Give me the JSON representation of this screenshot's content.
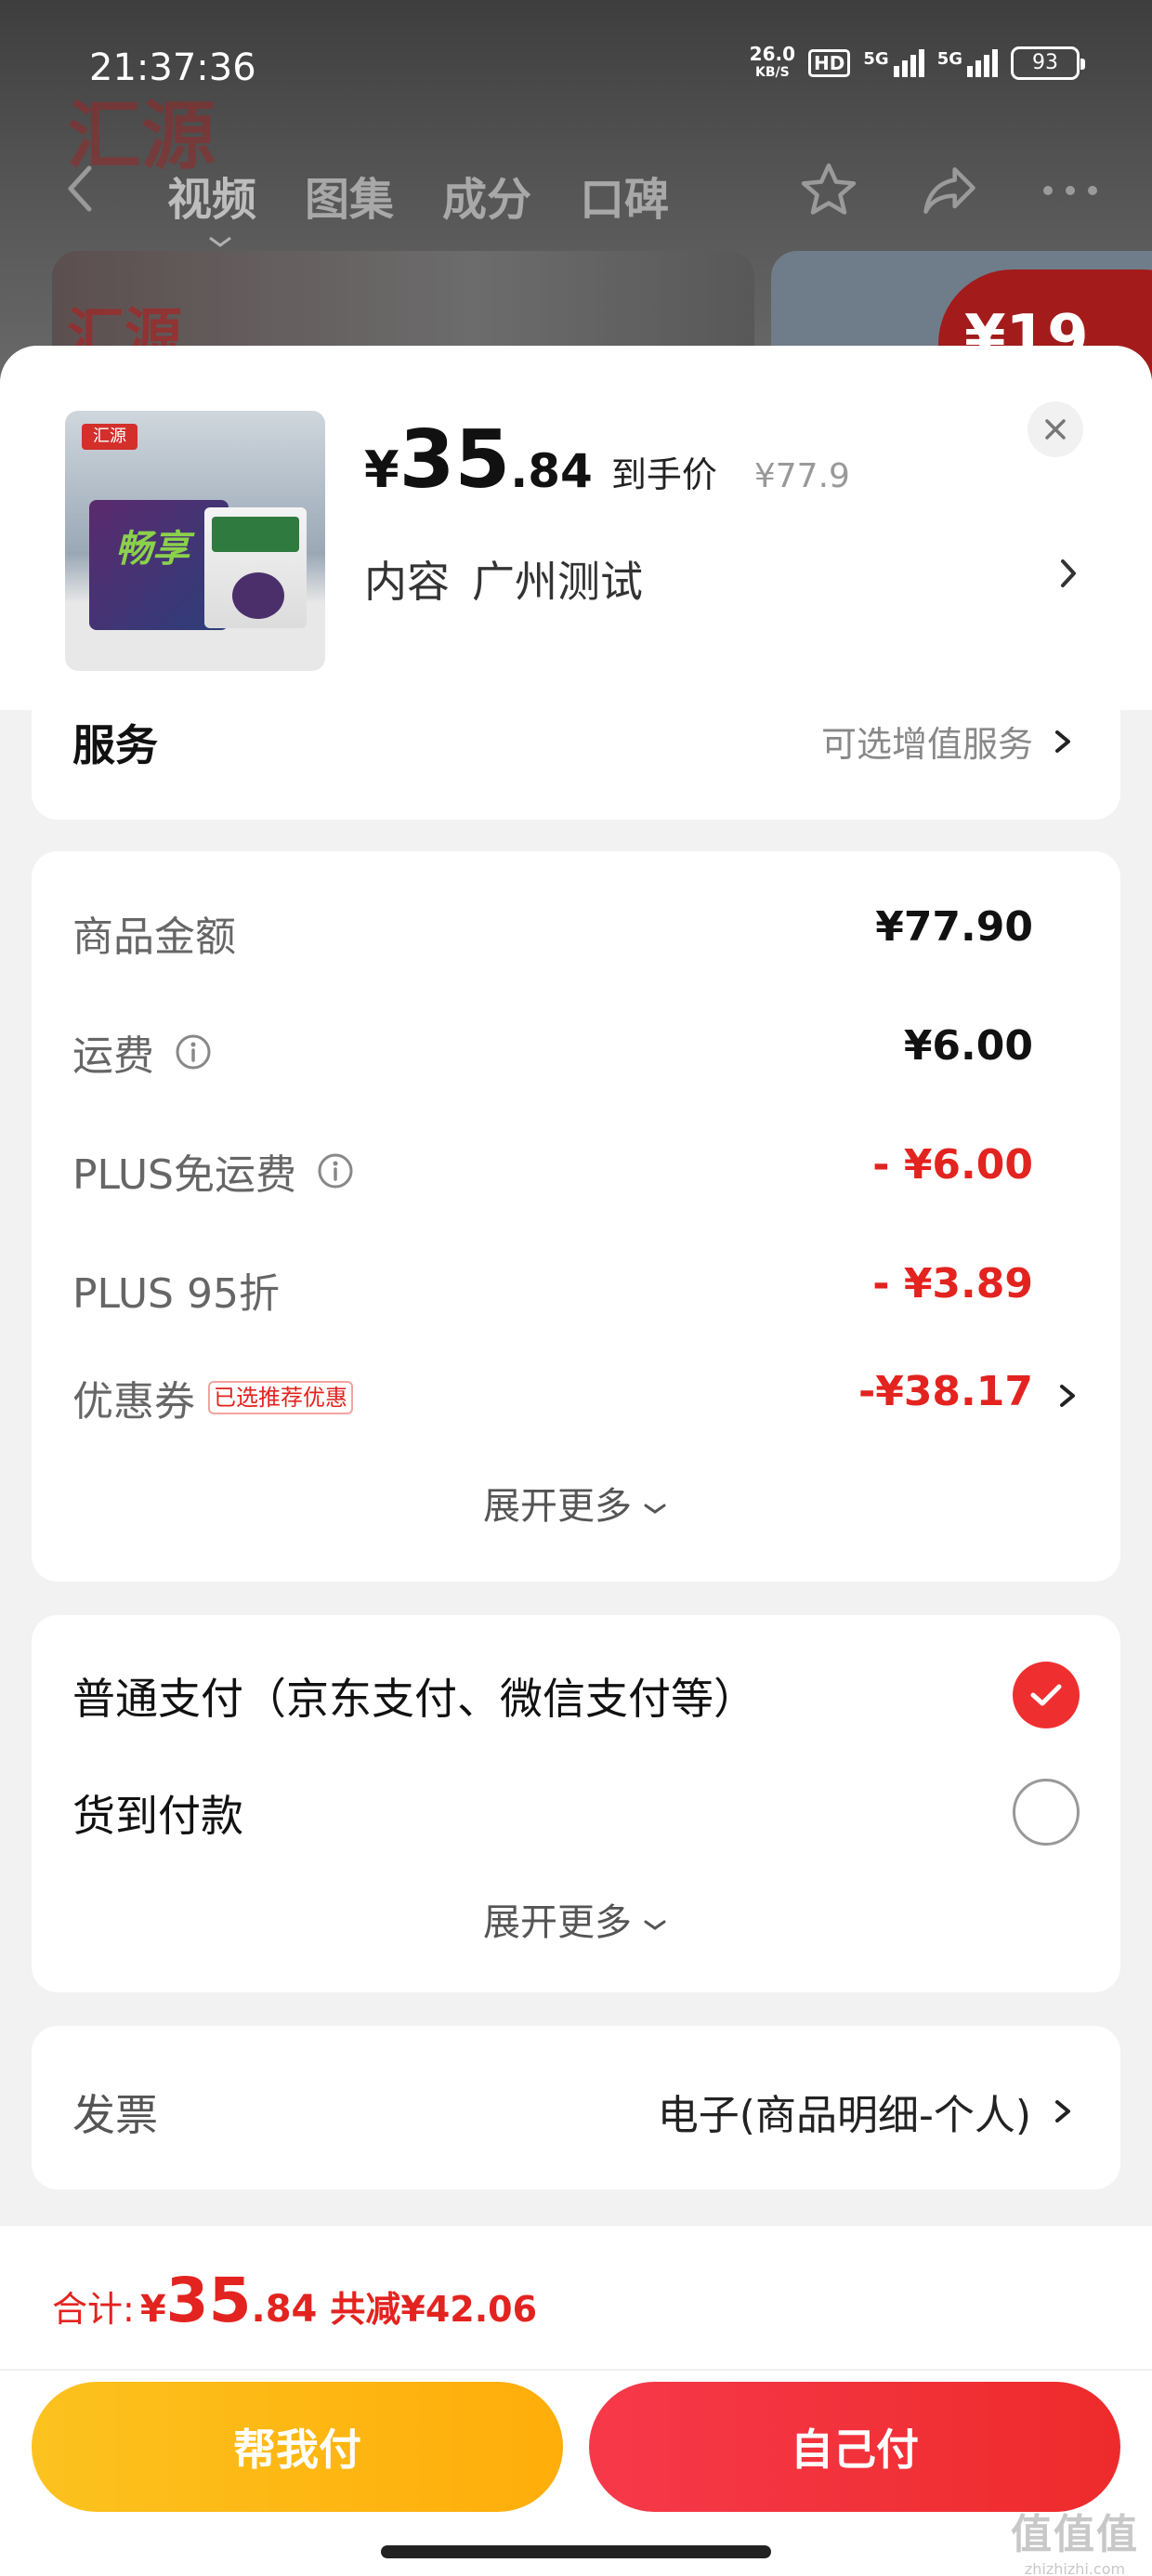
{
  "status_bar": {
    "time": "21:37:36",
    "net_speed_value": "26.0",
    "net_speed_unit": "KB/S",
    "hd_badge": "HD",
    "signal_1": "5G",
    "signal_2": "5G",
    "battery": "93"
  },
  "background": {
    "brand_logo": "汇源",
    "tabs": [
      "视频",
      "图集",
      "成分",
      "口碑"
    ],
    "side_tag": "¥19"
  },
  "product": {
    "currency": "¥",
    "price_int": "35",
    "price_dec": ".84",
    "price_tag": "到手价",
    "original_price": "¥77.9",
    "content_label": "内容",
    "content_value": "广州测试",
    "thumb_logo": "汇源",
    "thumb_text": "畅享"
  },
  "service": {
    "title": "服务",
    "hint": "可选增值服务"
  },
  "amounts": {
    "rows": [
      {
        "label": "商品金额",
        "value": "¥77.90"
      },
      {
        "label": "运费",
        "value": "¥6.00"
      },
      {
        "label": "PLUS免运费",
        "value": "- ¥6.00"
      },
      {
        "label": "PLUS 95折",
        "value": "- ¥3.89"
      },
      {
        "label": "优惠券",
        "badge": "已选推荐优惠",
        "value": "-¥38.17"
      }
    ],
    "expand": "展开更多"
  },
  "payment": {
    "options": [
      {
        "label": "普通支付（京东支付、微信支付等）",
        "selected": true
      },
      {
        "label": "货到付款",
        "selected": false
      }
    ],
    "expand": "展开更多"
  },
  "invoice": {
    "label": "发票",
    "value": "电子(商品明细-个人)"
  },
  "footer": {
    "total_label": "合计:",
    "total_yen": "¥",
    "total_int": "35",
    "total_dec": ".84",
    "total_saved": "共减¥42.06",
    "btn_friend": "帮我付",
    "btn_self": "自己付",
    "watermark_big": "值值值",
    "watermark_small": "zhizhizhi.com"
  },
  "colors": {
    "accent_red": "#e3231f",
    "button_yellow": "#fcc21f",
    "button_red": "#f6394a"
  },
  "icons": [
    "back-icon",
    "star-icon",
    "share-icon",
    "more-icon",
    "close-icon",
    "chevron-right-icon",
    "info-icon",
    "check-icon",
    "chevron-down-icon"
  ]
}
